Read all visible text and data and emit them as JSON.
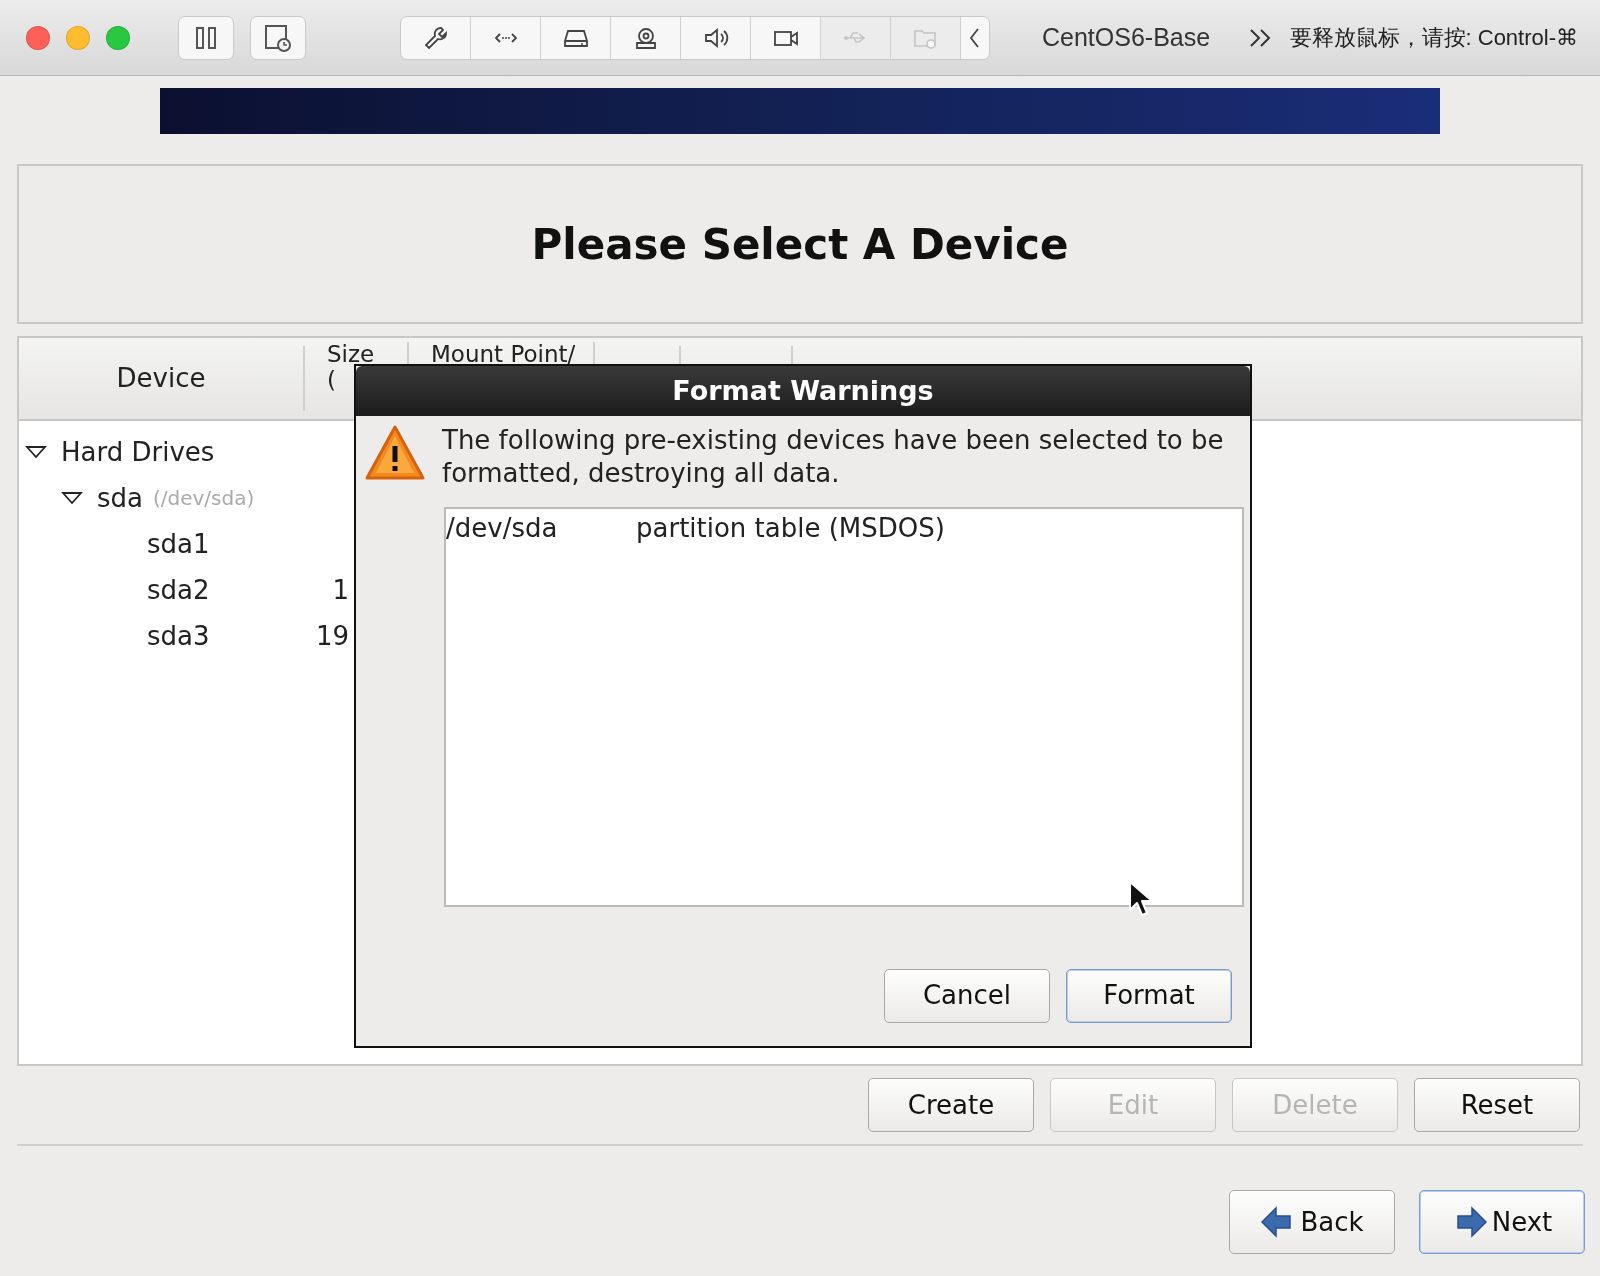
{
  "window": {
    "title": "CentOS6-Base",
    "hint": "要释放鼠标，请按: Control-⌘"
  },
  "toolbar": [
    {
      "kind": "wrench",
      "disabled": false
    },
    {
      "kind": "code",
      "disabled": false
    },
    {
      "kind": "drive",
      "disabled": false
    },
    {
      "kind": "webcam",
      "disabled": false
    },
    {
      "kind": "speaker",
      "disabled": false
    },
    {
      "kind": "video",
      "disabled": false
    },
    {
      "kind": "usb",
      "disabled": true
    },
    {
      "kind": "folder",
      "disabled": true
    },
    {
      "kind": "chevron",
      "disabled": false
    }
  ],
  "installer": {
    "title": "Please Select A Device",
    "table": {
      "columns": [
        {
          "lines": [
            "Device"
          ]
        },
        {
          "lines": [
            "Size",
            "("
          ]
        },
        {
          "lines": [
            "Mount Point/"
          ]
        }
      ],
      "tree": [
        {
          "name": "Hard Drives",
          "expanded": true,
          "children": [
            {
              "name": "sda",
              "path": "(/dev/sda)",
              "expanded": true,
              "children": [
                {
                  "name": "sda1"
                },
                {
                  "name": "sda2",
                  "size": "1"
                },
                {
                  "name": "sda3",
                  "size": "19"
                }
              ]
            }
          ]
        }
      ]
    },
    "buttons": [
      {
        "label": "Create",
        "disabled": false
      },
      {
        "label": "Edit",
        "disabled": true
      },
      {
        "label": "Delete",
        "disabled": true
      },
      {
        "label": "Reset",
        "disabled": false
      }
    ],
    "nav": [
      {
        "kind": "back",
        "label": "Back",
        "focused": false
      },
      {
        "kind": "next",
        "label": "Next",
        "focused": true
      }
    ]
  },
  "dialog": {
    "title": "Format Warnings",
    "message": "The following pre-existing devices have been selected to be formatted, destroying all data.",
    "rows": [
      {
        "device": "/dev/sda",
        "description": "partition table (MSDOS)"
      }
    ],
    "buttons": [
      {
        "label": "Cancel",
        "focused": false
      },
      {
        "label": "Format",
        "focused": true
      }
    ]
  }
}
